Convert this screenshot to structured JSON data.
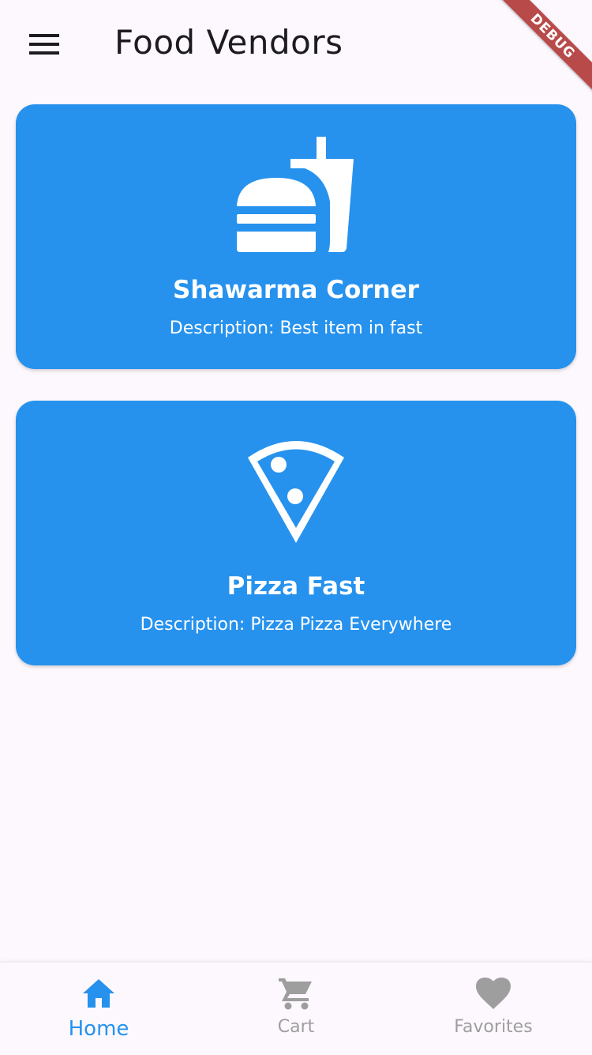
{
  "app_bar": {
    "menu_icon": "menu-icon",
    "title": "Food Vendors",
    "debug_label": "DEBUG"
  },
  "vendors": [
    {
      "icon": "fastfood-icon",
      "name": "Shawarma Corner",
      "description": "Description: Best item in fast"
    },
    {
      "icon": "pizza-slice-icon",
      "name": "Pizza Fast",
      "description": "Description: Pizza Pizza Everywhere"
    }
  ],
  "bottom_nav": {
    "items": [
      {
        "label": "Home",
        "icon": "home-icon",
        "selected": true
      },
      {
        "label": "Cart",
        "icon": "cart-icon",
        "selected": false
      },
      {
        "label": "Favorites",
        "icon": "heart-icon",
        "selected": false
      }
    ]
  },
  "colors": {
    "card_background": "#2692ee",
    "active_nav": "#2692ee",
    "inactive_nav": "#9e9e9e",
    "page_background": "#fdf8fd",
    "debug_banner": "#b94a4a"
  }
}
